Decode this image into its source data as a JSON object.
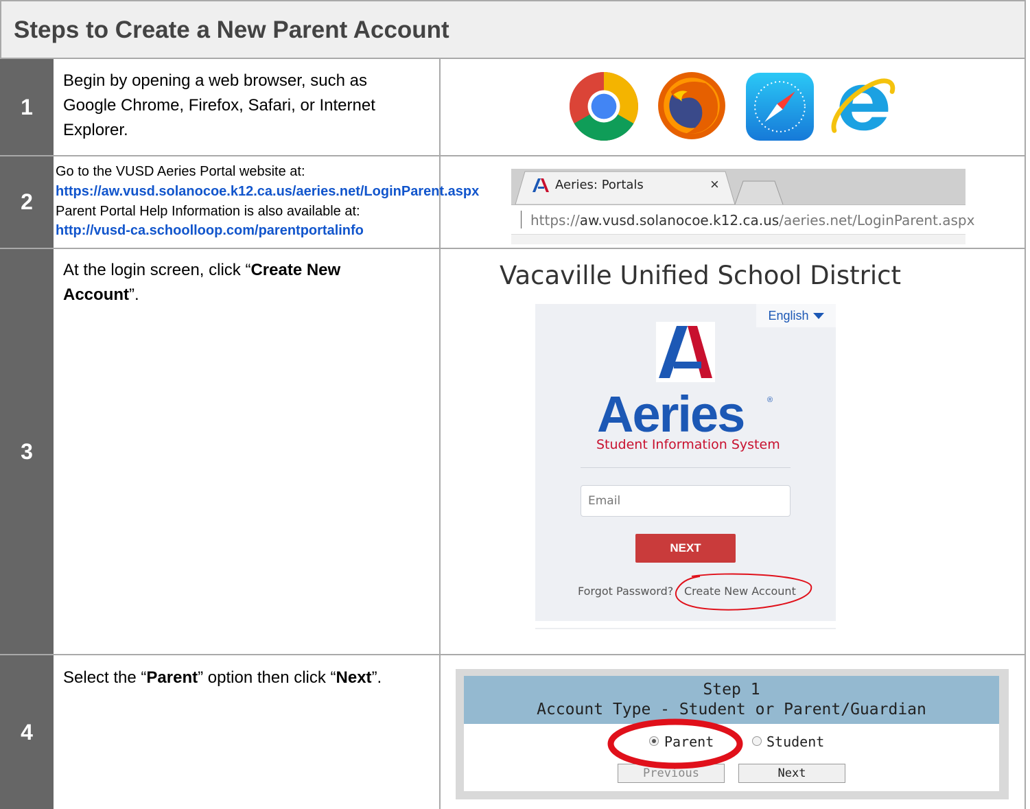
{
  "header": {
    "title": "Steps to Create a New Parent Account"
  },
  "steps": [
    {
      "number": "1",
      "text": "Begin by opening a web browser, such as Google Chrome, Firefox, Safari, or Internet Explorer.",
      "browser_icons": [
        "chrome-icon",
        "firefox-icon",
        "safari-icon",
        "internet-explorer-icon"
      ]
    },
    {
      "number": "2",
      "line1": "Go to the VUSD Aeries Portal website at:",
      "link1": "https://aw.vusd.solanocoe.k12.ca.us/aeries.net/LoginParent.aspx",
      "line2": "Parent Portal Help Information is also available at:",
      "link2": "http://vusd-ca.schoolloop.com/parentportalinfo",
      "browser": {
        "tab_title": "Aeries: Portals",
        "tab_close": "×",
        "url_prefix": "https://",
        "url_host": "aw.vusd.solanocoe.k12.ca.us",
        "url_path": "/aeries.net/LoginParent.aspx"
      }
    },
    {
      "number": "3",
      "text_pre": "At the login screen, click “",
      "text_bold": "Create New Account",
      "text_post": "”.",
      "login": {
        "district": "Vacaville Unified School District",
        "language": "English",
        "brand": "Aeries",
        "brand_mark": "®",
        "subtitle": "Student Information System",
        "email_placeholder": "Email",
        "next_label": "NEXT",
        "forgot_label": "Forgot Password?",
        "create_label": "Create New Account"
      }
    },
    {
      "number": "4",
      "text_pre": "Select the “",
      "text_bold1": "Parent",
      "text_mid": "” option then click “",
      "text_bold2": "Next",
      "text_post": "”.",
      "account_type": {
        "heading_line1": "Step 1",
        "heading_line2": "Account Type - Student or Parent/Guardian",
        "option_parent": "Parent",
        "option_student": "Student",
        "selected": "Parent",
        "prev_label": "Previous",
        "next_label": "Next"
      }
    }
  ],
  "colors": {
    "step_number_bg": "#666666",
    "link": "#1155cc",
    "aeries_blue": "#1c58b5",
    "aeries_red": "#c8102e",
    "next_button": "#c93b3b",
    "annotation_red": "#e0101a",
    "step_header_blue": "#94b9d0"
  }
}
